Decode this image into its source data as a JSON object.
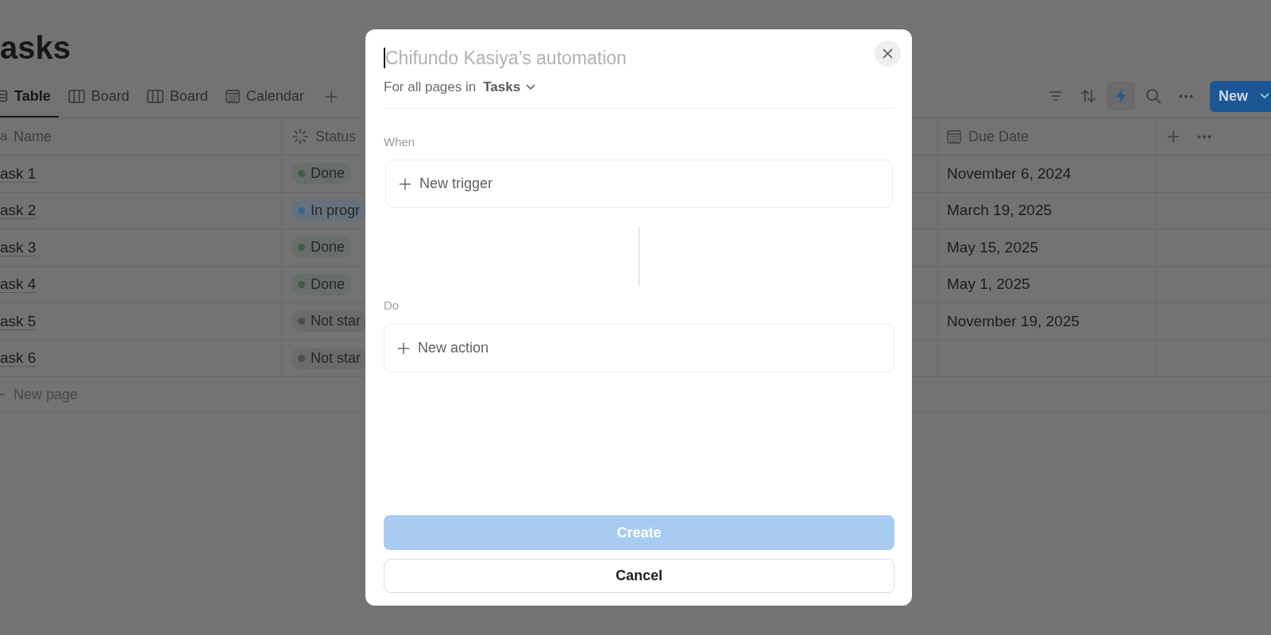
{
  "page": {
    "title": "asks"
  },
  "views": [
    {
      "kind": "table",
      "label": "Table",
      "selected": true
    },
    {
      "kind": "board",
      "label": "Board",
      "selected": false
    },
    {
      "kind": "board",
      "label": "Board",
      "selected": false
    },
    {
      "kind": "calendar",
      "label": "Calendar",
      "selected": false
    }
  ],
  "toolbar": {
    "tools": [
      {
        "kind": "filter",
        "selected": false
      },
      {
        "kind": "sort",
        "selected": false
      },
      {
        "kind": "automation",
        "selected": true
      },
      {
        "kind": "search",
        "selected": false
      },
      {
        "kind": "more",
        "selected": false
      }
    ],
    "new_button": "New"
  },
  "table": {
    "columns": [
      {
        "kind": "title",
        "glyph": "a",
        "label": "Name"
      },
      {
        "kind": "status",
        "label": "Status"
      },
      {
        "kind": "date",
        "label": "Due Date"
      }
    ],
    "rows": [
      {
        "name": "ask 1",
        "status": {
          "label": "Done",
          "color": "#3f5e47"
        },
        "due_date": "November 6, 2024"
      },
      {
        "name": "ask 2",
        "status": {
          "label": "In progr",
          "color": "#3a6590"
        },
        "due_date": "March 19, 2025"
      },
      {
        "name": "ask 3",
        "status": {
          "label": "Done",
          "color": "#3f5e47"
        },
        "due_date": "May 15, 2025"
      },
      {
        "name": "ask 4",
        "status": {
          "label": "Done",
          "color": "#3f5e47"
        },
        "due_date": "May 1, 2025"
      },
      {
        "name": "ask 5",
        "status": {
          "label": "Not star",
          "color": "#4d4d4d"
        },
        "due_date": "November 19, 2025"
      },
      {
        "name": "ask 6",
        "status": {
          "label": "Not star",
          "color": "#4d4d4d"
        }
      }
    ],
    "new_row": "New page"
  },
  "dialog": {
    "name_field": {
      "placeholder": "Chifundo Kasiya’s automation"
    },
    "scope": {
      "label": "For all pages in",
      "database": "Tasks"
    },
    "sections": [
      {
        "label": "When",
        "button": "New trigger"
      },
      {
        "label": "Do",
        "button": "New action"
      }
    ],
    "buttons": [
      {
        "kind": "primary",
        "label": "Create",
        "disabled": true
      },
      {
        "kind": "secondary",
        "label": "Cancel",
        "disabled": false
      }
    ]
  }
}
